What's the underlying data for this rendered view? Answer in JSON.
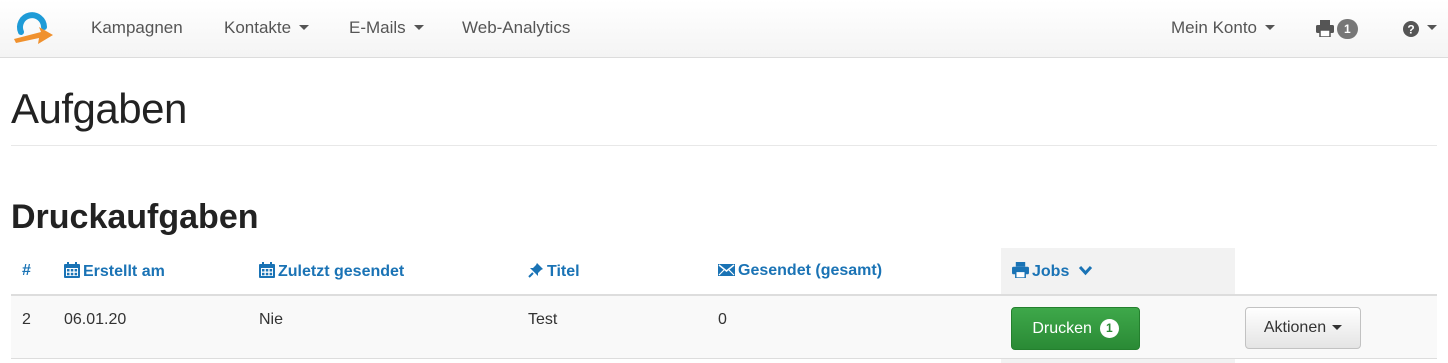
{
  "navbar": {
    "logo_icon": "brand-logo",
    "items": [
      {
        "label": "Kampagnen"
      },
      {
        "label": "Kontakte"
      },
      {
        "label": "E-Mails"
      },
      {
        "label": "Web-Analytics"
      }
    ],
    "account_label": "Mein Konto",
    "print_icon": "printer-icon",
    "print_count": "1",
    "help_icon": "question-circle-icon"
  },
  "page": {
    "title": "Aufgaben",
    "section_title": "Druckaufgaben"
  },
  "table": {
    "columns": [
      {
        "label": "#",
        "icon": ""
      },
      {
        "label": "Erstellt am",
        "icon": "calendar-icon"
      },
      {
        "label": "Zuletzt gesendet",
        "icon": "calendar-icon"
      },
      {
        "label": "Titel",
        "icon": "pin-icon"
      },
      {
        "label": "Gesendet (gesamt)",
        "icon": "envelope-icon"
      },
      {
        "label": "Jobs",
        "icon": "printer-icon",
        "sort": "chevron-down-icon"
      }
    ],
    "rows": [
      {
        "id": "2",
        "created": "06.01.20",
        "last_sent": "Nie",
        "title": "Test",
        "sent_total": "0",
        "print_label": "Drucken",
        "print_count": "1",
        "actions_label": "Aktionen"
      }
    ]
  },
  "colors": {
    "link": "#1a73b5",
    "print_button": "#2f9a3c",
    "logo_blue": "#1e9bd7",
    "logo_orange": "#f0912e"
  }
}
